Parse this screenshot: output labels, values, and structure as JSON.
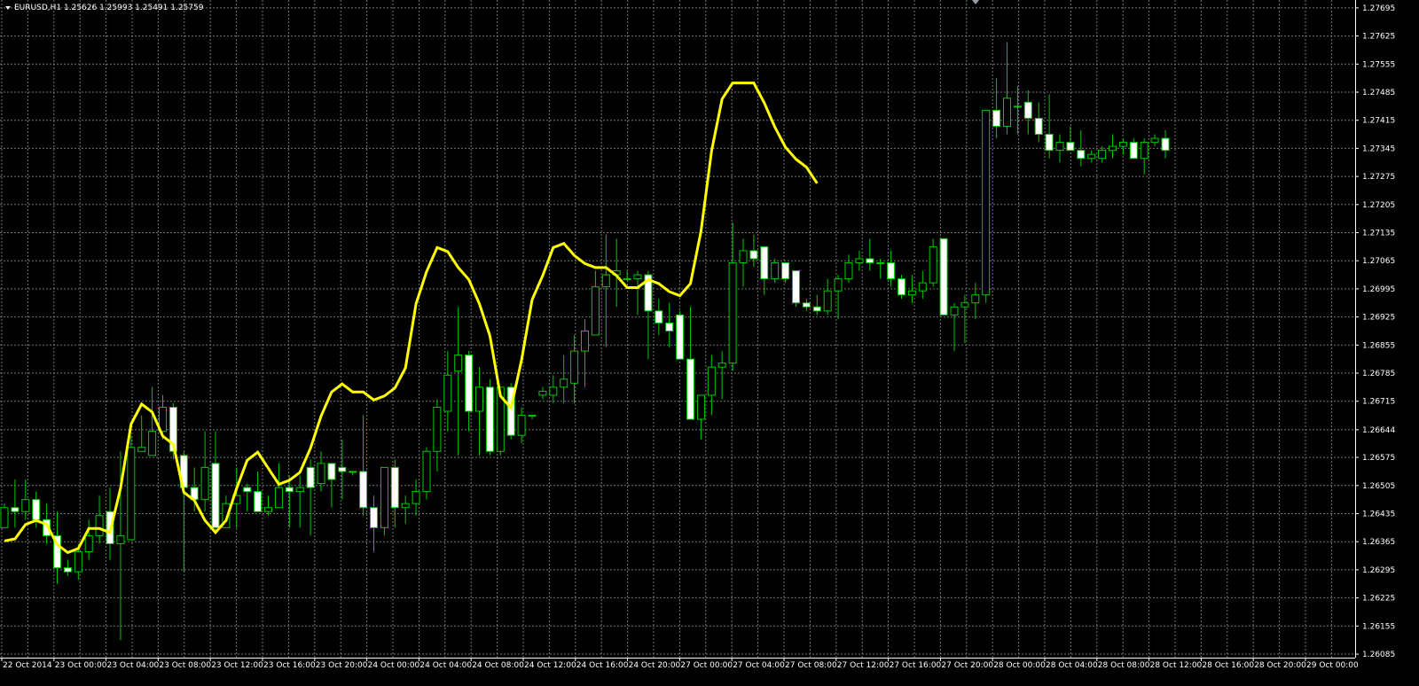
{
  "header": {
    "symbol": "EURUSD,H1",
    "ohlc": "1.25626 1.25993 1.25491 1.25759"
  },
  "colors": {
    "background": "#000000",
    "grid": "#6f7a6f",
    "bull_body": "#000000",
    "bear_body": "#ffffff",
    "candle_border": "#00c800",
    "wick": "#00c800",
    "ma_line": "#ffff00",
    "axis_text": "#ffffff"
  },
  "chart_data": {
    "type": "candlestick",
    "symbol": "EURUSD",
    "timeframe": "H1",
    "ylim": [
      1.2605,
      1.2772
    ],
    "y_ticks": [
      "1.27695",
      "1.27625",
      "1.27555",
      "1.27485",
      "1.27415",
      "1.27345",
      "1.27275",
      "1.27205",
      "1.27135",
      "1.27065",
      "1.26995",
      "1.26925",
      "1.26855",
      "1.26785",
      "1.26715",
      "1.26644",
      "1.26575",
      "1.26505",
      "1.26435",
      "1.26365",
      "1.26295",
      "1.26225",
      "1.26155",
      "1.26085"
    ],
    "x_ticks": [
      "22 Oct 2014",
      "23 Oct 00:00",
      "23 Oct 04:00",
      "23 Oct 08:00",
      "23 Oct 12:00",
      "23 Oct 16:00",
      "23 Oct 20:00",
      "24 Oct 00:00",
      "24 Oct 04:00",
      "24 Oct 08:00",
      "24 Oct 12:00",
      "24 Oct 16:00",
      "24 Oct 20:00",
      "27 Oct 00:00",
      "27 Oct 04:00",
      "27 Oct 08:00",
      "27 Oct 12:00",
      "27 Oct 16:00",
      "27 Oct 20:00",
      "28 Oct 00:00",
      "28 Oct 04:00",
      "28 Oct 08:00",
      "28 Oct 12:00",
      "28 Oct 16:00",
      "28 Oct 20:00",
      "29 Oct 00:00"
    ],
    "grid": true,
    "candles": [
      [
        1.264,
        1.2646,
        1.264,
        1.2645
      ],
      [
        1.2645,
        1.2652,
        1.264,
        1.2644
      ],
      [
        1.2644,
        1.2652,
        1.2642,
        1.2647
      ],
      [
        1.2647,
        1.2649,
        1.264,
        1.2642
      ],
      [
        1.2642,
        1.2646,
        1.2636,
        1.2638
      ],
      [
        1.2638,
        1.2644,
        1.2626,
        1.263
      ],
      [
        1.263,
        1.2632,
        1.2628,
        1.2629
      ],
      [
        1.2629,
        1.2636,
        1.2627,
        1.2634
      ],
      [
        1.2634,
        1.2642,
        1.2632,
        1.2638
      ],
      [
        1.2638,
        1.2648,
        1.2636,
        1.2643
      ],
      [
        1.2644,
        1.265,
        1.2632,
        1.2636
      ],
      [
        1.2636,
        1.2659,
        1.2612,
        1.2638
      ],
      [
        1.2637,
        1.2663,
        1.2637,
        1.266
      ],
      [
        1.2659,
        1.2668,
        1.2659,
        1.266
      ],
      [
        1.2658,
        1.2675,
        1.2658,
        1.2664
      ],
      [
        1.2664,
        1.2673,
        1.2662,
        1.267
      ],
      [
        1.267,
        1.2671,
        1.2657,
        1.2659
      ],
      [
        1.2658,
        1.2659,
        1.2629,
        1.265
      ],
      [
        1.265,
        1.2655,
        1.2644,
        1.2647
      ],
      [
        1.2647,
        1.2664,
        1.2644,
        1.2655
      ],
      [
        1.2656,
        1.2664,
        1.2639,
        1.264
      ],
      [
        1.264,
        1.2648,
        1.264,
        1.2646
      ],
      [
        1.2646,
        1.2655,
        1.264,
        1.2648
      ],
      [
        1.265,
        1.2651,
        1.2644,
        1.2649
      ],
      [
        1.2649,
        1.2654,
        1.2645,
        1.2644
      ],
      [
        1.2644,
        1.2648,
        1.2643,
        1.2645
      ],
      [
        1.2645,
        1.2656,
        1.2645,
        1.265
      ],
      [
        1.265,
        1.2653,
        1.264,
        1.2649
      ],
      [
        1.2649,
        1.2653,
        1.264,
        1.265
      ],
      [
        1.2655,
        1.2657,
        1.2638,
        1.265
      ],
      [
        1.2651,
        1.2659,
        1.2649,
        1.2656
      ],
      [
        1.2656,
        1.2656,
        1.2645,
        1.2652
      ],
      [
        1.2655,
        1.2662,
        1.2647,
        1.2654
      ],
      [
        1.2654,
        1.2654,
        1.2653,
        1.2654
      ],
      [
        1.2654,
        1.2668,
        1.2643,
        1.2645
      ],
      [
        1.2645,
        1.2648,
        1.2634,
        1.264
      ],
      [
        1.264,
        1.2655,
        1.2638,
        1.2655
      ],
      [
        1.2655,
        1.2657,
        1.264,
        1.2645
      ],
      [
        1.2645,
        1.2648,
        1.2641,
        1.2646
      ],
      [
        1.2646,
        1.2652,
        1.2643,
        1.2649
      ],
      [
        1.2649,
        1.266,
        1.2647,
        1.2659
      ],
      [
        1.2659,
        1.2672,
        1.2654,
        1.267
      ],
      [
        1.2669,
        1.2684,
        1.2664,
        1.2678
      ],
      [
        1.2679,
        1.2695,
        1.2658,
        1.2683
      ],
      [
        1.2683,
        1.2684,
        1.2664,
        1.2669
      ],
      [
        1.2669,
        1.268,
        1.2658,
        1.2675
      ],
      [
        1.2675,
        1.2677,
        1.2658,
        1.2659
      ],
      [
        1.2659,
        1.2675,
        1.2658,
        1.2675
      ],
      [
        1.2675,
        1.2676,
        1.2662,
        1.2663
      ],
      [
        1.2663,
        1.267,
        1.2661,
        1.2668
      ],
      [
        1.2668,
        1.2668,
        1.2667,
        1.2668
      ],
      [
        1.2673,
        1.2675,
        1.2672,
        1.2674
      ],
      [
        1.2673,
        1.2678,
        1.2671,
        1.2675
      ],
      [
        1.2675,
        1.2683,
        1.2671,
        1.2677
      ],
      [
        1.2676,
        1.2688,
        1.2671,
        1.2684
      ],
      [
        1.2684,
        1.2692,
        1.2675,
        1.2689
      ],
      [
        1.2688,
        1.2704,
        1.2688,
        1.27
      ],
      [
        1.27,
        1.2713,
        1.2685,
        1.2703
      ],
      [
        1.2703,
        1.2712,
        1.2695,
        1.2704
      ],
      [
        1.2702,
        1.2704,
        1.2702,
        1.2702
      ],
      [
        1.2702,
        1.2704,
        1.2693,
        1.2703
      ],
      [
        1.2703,
        1.2704,
        1.2682,
        1.2694
      ],
      [
        1.2694,
        1.2697,
        1.2688,
        1.2691
      ],
      [
        1.2691,
        1.2696,
        1.2685,
        1.2689
      ],
      [
        1.2693,
        1.2694,
        1.2683,
        1.2682
      ],
      [
        1.2682,
        1.2695,
        1.2673,
        1.2667
      ],
      [
        1.2667,
        1.2673,
        1.2662,
        1.2673
      ],
      [
        1.2673,
        1.2683,
        1.2668,
        1.268
      ],
      [
        1.268,
        1.2684,
        1.2672,
        1.2681
      ],
      [
        1.2681,
        1.2716,
        1.2679,
        1.2706
      ],
      [
        1.2706,
        1.2712,
        1.27,
        1.2709
      ],
      [
        1.2709,
        1.2713,
        1.2705,
        1.2707
      ],
      [
        1.271,
        1.271,
        1.2698,
        1.2702
      ],
      [
        1.2702,
        1.2707,
        1.2701,
        1.2706
      ],
      [
        1.2706,
        1.2706,
        1.2701,
        1.2702
      ],
      [
        1.2704,
        1.2704,
        1.2695,
        1.2696
      ],
      [
        1.2696,
        1.2697,
        1.2694,
        1.2695
      ],
      [
        1.2695,
        1.2698,
        1.2693,
        1.2694
      ],
      [
        1.2694,
        1.2702,
        1.2693,
        1.2699
      ],
      [
        1.2699,
        1.2703,
        1.2692,
        1.2702
      ],
      [
        1.2702,
        1.2708,
        1.2701,
        1.2706
      ],
      [
        1.2706,
        1.2709,
        1.2704,
        1.2707
      ],
      [
        1.2707,
        1.2712,
        1.2704,
        1.2706
      ],
      [
        1.2706,
        1.2707,
        1.2702,
        1.2706
      ],
      [
        1.2706,
        1.2709,
        1.27,
        1.2702
      ],
      [
        1.2702,
        1.2703,
        1.2697,
        1.2698
      ],
      [
        1.2698,
        1.2703,
        1.2696,
        1.2699
      ],
      [
        1.2699,
        1.2704,
        1.2697,
        1.2701
      ],
      [
        1.2701,
        1.2712,
        1.27,
        1.271
      ],
      [
        1.2712,
        1.2712,
        1.2693,
        1.2693
      ],
      [
        1.2693,
        1.2696,
        1.2684,
        1.2695
      ],
      [
        1.2695,
        1.2698,
        1.2686,
        1.2696
      ],
      [
        1.2696,
        1.2701,
        1.2692,
        1.2698
      ],
      [
        1.2698,
        1.2735,
        1.2696,
        1.2744
      ],
      [
        1.2744,
        1.2752,
        1.2737,
        1.274
      ],
      [
        1.274,
        1.2761,
        1.2738,
        1.2747
      ],
      [
        1.2745,
        1.275,
        1.2738,
        1.2745
      ],
      [
        1.2746,
        1.2749,
        1.2738,
        1.2742
      ],
      [
        1.2742,
        1.2746,
        1.2736,
        1.2738
      ],
      [
        1.2738,
        1.2748,
        1.2732,
        1.2734
      ],
      [
        1.2734,
        1.2738,
        1.2731,
        1.2736
      ],
      [
        1.2736,
        1.274,
        1.2735,
        1.2734
      ],
      [
        1.2734,
        1.2739,
        1.273,
        1.2732
      ],
      [
        1.2732,
        1.2734,
        1.2731,
        1.2733
      ],
      [
        1.2732,
        1.2735,
        1.2731,
        1.2734
      ],
      [
        1.2734,
        1.2738,
        1.2732,
        1.2735
      ],
      [
        1.2735,
        1.2737,
        1.2733,
        1.2736
      ],
      [
        1.2736,
        1.2737,
        1.2733,
        1.2732
      ],
      [
        1.2732,
        1.2737,
        1.2728,
        1.2736
      ],
      [
        1.2736,
        1.2738,
        1.2735,
        1.2737
      ],
      [
        1.2737,
        1.2739,
        1.2732,
        1.2734
      ]
    ],
    "ma": [
      1.26367,
      1.26372,
      1.26408,
      1.26418,
      1.26408,
      1.26358,
      1.26338,
      1.26348,
      1.26398,
      1.26398,
      1.26388,
      1.26498,
      1.26658,
      1.26708,
      1.26688,
      1.26628,
      1.26608,
      1.26488,
      1.26468,
      1.26418,
      1.26388,
      1.26418,
      1.26498,
      1.26568,
      1.26588,
      1.26548,
      1.26508,
      1.26518,
      1.26538,
      1.26598,
      1.26678,
      1.26738,
      1.26758,
      1.26738,
      1.26738,
      1.26718,
      1.26728,
      1.26748,
      1.26798,
      1.26958,
      1.27038,
      1.27098,
      1.27088,
      1.27048,
      1.27018,
      1.26958,
      1.26878,
      1.26728,
      1.26698,
      1.26818,
      1.26968,
      1.27028,
      1.27098,
      1.27108,
      1.27078,
      1.27058,
      1.27048,
      1.27048,
      1.27028,
      1.26998,
      1.26998,
      1.27018,
      1.27008,
      1.26988,
      1.26978,
      1.27008,
      1.27138,
      1.27338,
      1.27468,
      1.27508,
      1.27508,
      1.27508,
      1.27458,
      1.27398,
      1.27348,
      1.27318,
      1.27298,
      1.27258
    ]
  }
}
